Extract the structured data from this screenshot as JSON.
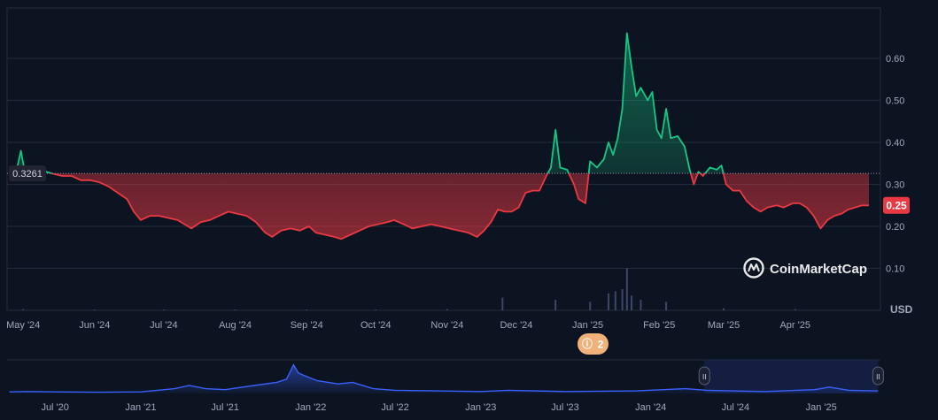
{
  "chart_data": [
    {
      "type": "line",
      "title": "",
      "unit_label": "USD",
      "baseline": 0.3261,
      "baseline_label": "0.3261",
      "current_value": 0.25,
      "current_label": "0.25",
      "ylim": [
        0,
        0.72
      ],
      "yticks": [
        {
          "value": 0.1,
          "label": "0.10"
        },
        {
          "value": 0.2,
          "label": "0.20"
        },
        {
          "value": 0.3,
          "label": "0.30"
        },
        {
          "value": 0.4,
          "label": "0.40"
        },
        {
          "value": 0.5,
          "label": "0.50"
        },
        {
          "value": 0.6,
          "label": "0.60"
        }
      ],
      "xlim": [
        "2024-04-24",
        "2025-05-08"
      ],
      "xticks": [
        {
          "date": "2024-05-01",
          "label": "May '24"
        },
        {
          "date": "2024-06-01",
          "label": "Jun '24"
        },
        {
          "date": "2024-07-01",
          "label": "Jul '24"
        },
        {
          "date": "2024-08-01",
          "label": "Aug '24"
        },
        {
          "date": "2024-09-01",
          "label": "Sep '24"
        },
        {
          "date": "2024-10-01",
          "label": "Oct '24"
        },
        {
          "date": "2024-11-01",
          "label": "Nov '24"
        },
        {
          "date": "2024-12-01",
          "label": "Dec '24"
        },
        {
          "date": "2025-01-01",
          "label": "Jan '25"
        },
        {
          "date": "2025-02-01",
          "label": "Feb '25"
        },
        {
          "date": "2025-03-01",
          "label": "Mar '25"
        },
        {
          "date": "2025-04-01",
          "label": "Apr '25"
        }
      ],
      "series": [
        {
          "points": [
            [
              "2024-04-25",
              0.325
            ],
            [
              "2024-04-28",
              0.33
            ],
            [
              "2024-04-30",
              0.38
            ],
            [
              "2024-05-02",
              0.32
            ],
            [
              "2024-05-05",
              0.32
            ],
            [
              "2024-05-08",
              0.325
            ],
            [
              "2024-05-11",
              0.33
            ],
            [
              "2024-05-14",
              0.325
            ],
            [
              "2024-05-18",
              0.32
            ],
            [
              "2024-05-22",
              0.32
            ],
            [
              "2024-05-26",
              0.31
            ],
            [
              "2024-05-30",
              0.31
            ],
            [
              "2024-06-03",
              0.305
            ],
            [
              "2024-06-07",
              0.295
            ],
            [
              "2024-06-11",
              0.28
            ],
            [
              "2024-06-15",
              0.265
            ],
            [
              "2024-06-18",
              0.235
            ],
            [
              "2024-06-21",
              0.215
            ],
            [
              "2024-06-25",
              0.225
            ],
            [
              "2024-06-29",
              0.225
            ],
            [
              "2024-07-03",
              0.22
            ],
            [
              "2024-07-07",
              0.215
            ],
            [
              "2024-07-10",
              0.205
            ],
            [
              "2024-07-13",
              0.195
            ],
            [
              "2024-07-17",
              0.21
            ],
            [
              "2024-07-21",
              0.215
            ],
            [
              "2024-07-25",
              0.225
            ],
            [
              "2024-07-29",
              0.235
            ],
            [
              "2024-08-02",
              0.23
            ],
            [
              "2024-08-06",
              0.225
            ],
            [
              "2024-08-10",
              0.21
            ],
            [
              "2024-08-14",
              0.185
            ],
            [
              "2024-08-17",
              0.175
            ],
            [
              "2024-08-21",
              0.19
            ],
            [
              "2024-08-25",
              0.195
            ],
            [
              "2024-08-29",
              0.19
            ],
            [
              "2024-09-02",
              0.2
            ],
            [
              "2024-09-05",
              0.185
            ],
            [
              "2024-09-09",
              0.18
            ],
            [
              "2024-09-13",
              0.175
            ],
            [
              "2024-09-16",
              0.17
            ],
            [
              "2024-09-20",
              0.18
            ],
            [
              "2024-09-24",
              0.19
            ],
            [
              "2024-09-28",
              0.2
            ],
            [
              "2024-10-02",
              0.205
            ],
            [
              "2024-10-06",
              0.21
            ],
            [
              "2024-10-09",
              0.215
            ],
            [
              "2024-10-13",
              0.205
            ],
            [
              "2024-10-17",
              0.195
            ],
            [
              "2024-10-21",
              0.2
            ],
            [
              "2024-10-25",
              0.205
            ],
            [
              "2024-10-29",
              0.2
            ],
            [
              "2024-11-02",
              0.195
            ],
            [
              "2024-11-06",
              0.19
            ],
            [
              "2024-11-10",
              0.185
            ],
            [
              "2024-11-14",
              0.175
            ],
            [
              "2024-11-17",
              0.19
            ],
            [
              "2024-11-20",
              0.21
            ],
            [
              "2024-11-23",
              0.24
            ],
            [
              "2024-11-26",
              0.235
            ],
            [
              "2024-11-29",
              0.235
            ],
            [
              "2024-12-02",
              0.245
            ],
            [
              "2024-12-05",
              0.28
            ],
            [
              "2024-12-08",
              0.285
            ],
            [
              "2024-12-11",
              0.285
            ],
            [
              "2024-12-14",
              0.32
            ],
            [
              "2024-12-16",
              0.34
            ],
            [
              "2024-12-18",
              0.43
            ],
            [
              "2024-12-20",
              0.34
            ],
            [
              "2024-12-23",
              0.335
            ],
            [
              "2024-12-26",
              0.3
            ],
            [
              "2024-12-28",
              0.265
            ],
            [
              "2024-12-31",
              0.255
            ],
            [
              "2025-01-02",
              0.355
            ],
            [
              "2025-01-05",
              0.34
            ],
            [
              "2025-01-08",
              0.36
            ],
            [
              "2025-01-10",
              0.4
            ],
            [
              "2025-01-12",
              0.37
            ],
            [
              "2025-01-14",
              0.41
            ],
            [
              "2025-01-16",
              0.48
            ],
            [
              "2025-01-18",
              0.66
            ],
            [
              "2025-01-20",
              0.58
            ],
            [
              "2025-01-22",
              0.51
            ],
            [
              "2025-01-24",
              0.53
            ],
            [
              "2025-01-27",
              0.5
            ],
            [
              "2025-01-29",
              0.52
            ],
            [
              "2025-01-31",
              0.43
            ],
            [
              "2025-02-02",
              0.41
            ],
            [
              "2025-02-04",
              0.48
            ],
            [
              "2025-02-06",
              0.41
            ],
            [
              "2025-02-09",
              0.415
            ],
            [
              "2025-02-12",
              0.39
            ],
            [
              "2025-02-14",
              0.34
            ],
            [
              "2025-02-16",
              0.3
            ],
            [
              "2025-02-18",
              0.33
            ],
            [
              "2025-02-20",
              0.32
            ],
            [
              "2025-02-23",
              0.34
            ],
            [
              "2025-02-26",
              0.335
            ],
            [
              "2025-02-28",
              0.345
            ],
            [
              "2025-03-02",
              0.3
            ],
            [
              "2025-03-05",
              0.285
            ],
            [
              "2025-03-08",
              0.285
            ],
            [
              "2025-03-11",
              0.26
            ],
            [
              "2025-03-14",
              0.245
            ],
            [
              "2025-03-17",
              0.235
            ],
            [
              "2025-03-20",
              0.245
            ],
            [
              "2025-03-24",
              0.25
            ],
            [
              "2025-03-27",
              0.245
            ],
            [
              "2025-03-31",
              0.255
            ],
            [
              "2025-04-03",
              0.255
            ],
            [
              "2025-04-06",
              0.245
            ],
            [
              "2025-04-09",
              0.225
            ],
            [
              "2025-04-12",
              0.195
            ],
            [
              "2025-04-15",
              0.215
            ],
            [
              "2025-04-18",
              0.225
            ],
            [
              "2025-04-21",
              0.23
            ],
            [
              "2025-04-24",
              0.24
            ],
            [
              "2025-04-27",
              0.245
            ],
            [
              "2025-04-30",
              0.25
            ],
            [
              "2025-05-03",
              0.25
            ]
          ],
          "above_color": "#16c784",
          "below_color": "#ea3943"
        }
      ],
      "volume": [
        [
          "2024-05-01",
          0.03
        ],
        [
          "2024-06-01",
          0.02
        ],
        [
          "2024-07-01",
          0.02
        ],
        [
          "2024-08-01",
          0.02
        ],
        [
          "2024-09-01",
          0.02
        ],
        [
          "2024-10-01",
          0.02
        ],
        [
          "2024-11-01",
          0.03
        ],
        [
          "2024-11-25",
          0.3
        ],
        [
          "2024-12-18",
          0.25
        ],
        [
          "2025-01-02",
          0.2
        ],
        [
          "2025-01-10",
          0.4
        ],
        [
          "2025-01-13",
          0.45
        ],
        [
          "2025-01-16",
          0.5
        ],
        [
          "2025-01-18",
          1.0
        ],
        [
          "2025-01-20",
          0.35
        ],
        [
          "2025-01-24",
          0.25
        ],
        [
          "2025-02-04",
          0.2
        ],
        [
          "2025-03-01",
          0.05
        ],
        [
          "2025-04-01",
          0.03
        ]
      ]
    },
    {
      "type": "area",
      "title": "",
      "xticks": [
        {
          "date": "2020-07-01",
          "label": "Jul '20"
        },
        {
          "date": "2021-01-01",
          "label": "Jan '21"
        },
        {
          "date": "2021-07-01",
          "label": "Jul '21"
        },
        {
          "date": "2022-01-01",
          "label": "Jan '22"
        },
        {
          "date": "2022-07-01",
          "label": "Jul '22"
        },
        {
          "date": "2023-01-01",
          "label": "Jan '23"
        },
        {
          "date": "2023-07-01",
          "label": "Jul '23"
        },
        {
          "date": "2024-01-01",
          "label": "Jan '24"
        },
        {
          "date": "2024-07-01",
          "label": "Jul '24"
        },
        {
          "date": "2025-01-01",
          "label": "Jan '25"
        }
      ],
      "xlim": [
        "2020-03-20",
        "2025-05-08"
      ],
      "selected_range": [
        "2024-04-25",
        "2025-05-03"
      ],
      "series": [
        {
          "points": [
            [
              "2020-03-25",
              0.05
            ],
            [
              "2020-05-01",
              0.06
            ],
            [
              "2020-07-01",
              0.05
            ],
            [
              "2020-10-01",
              0.04
            ],
            [
              "2021-01-01",
              0.05
            ],
            [
              "2021-03-15",
              0.15
            ],
            [
              "2021-04-15",
              0.25
            ],
            [
              "2021-05-20",
              0.15
            ],
            [
              "2021-07-01",
              0.12
            ],
            [
              "2021-09-01",
              0.25
            ],
            [
              "2021-10-20",
              0.35
            ],
            [
              "2021-11-10",
              0.45
            ],
            [
              "2021-11-25",
              0.9
            ],
            [
              "2021-12-05",
              0.65
            ],
            [
              "2021-12-20",
              0.55
            ],
            [
              "2022-01-15",
              0.4
            ],
            [
              "2022-03-01",
              0.3
            ],
            [
              "2022-04-01",
              0.35
            ],
            [
              "2022-05-15",
              0.15
            ],
            [
              "2022-07-01",
              0.1
            ],
            [
              "2022-10-01",
              0.08
            ],
            [
              "2023-01-01",
              0.06
            ],
            [
              "2023-03-01",
              0.1
            ],
            [
              "2023-07-01",
              0.06
            ],
            [
              "2023-12-01",
              0.08
            ],
            [
              "2024-03-15",
              0.15
            ],
            [
              "2024-05-01",
              0.1
            ],
            [
              "2024-09-01",
              0.06
            ],
            [
              "2024-12-18",
              0.12
            ],
            [
              "2025-01-18",
              0.2
            ],
            [
              "2025-03-01",
              0.1
            ],
            [
              "2025-05-03",
              0.08
            ]
          ]
        }
      ],
      "ylim": [
        0,
        1
      ]
    }
  ],
  "toolbar": {
    "events_count": "2",
    "brand": "CoinMarketCap",
    "handle_left": "II",
    "handle_right": "II"
  },
  "colors": {
    "background": "#0d1421",
    "grid": "#222b3a",
    "axis_text": "#a1a7bb",
    "up": "#16c784",
    "down": "#ea3943",
    "navigator_line": "#3861fb",
    "event_badge": "#f0b27a",
    "volume": "#3a4766"
  }
}
